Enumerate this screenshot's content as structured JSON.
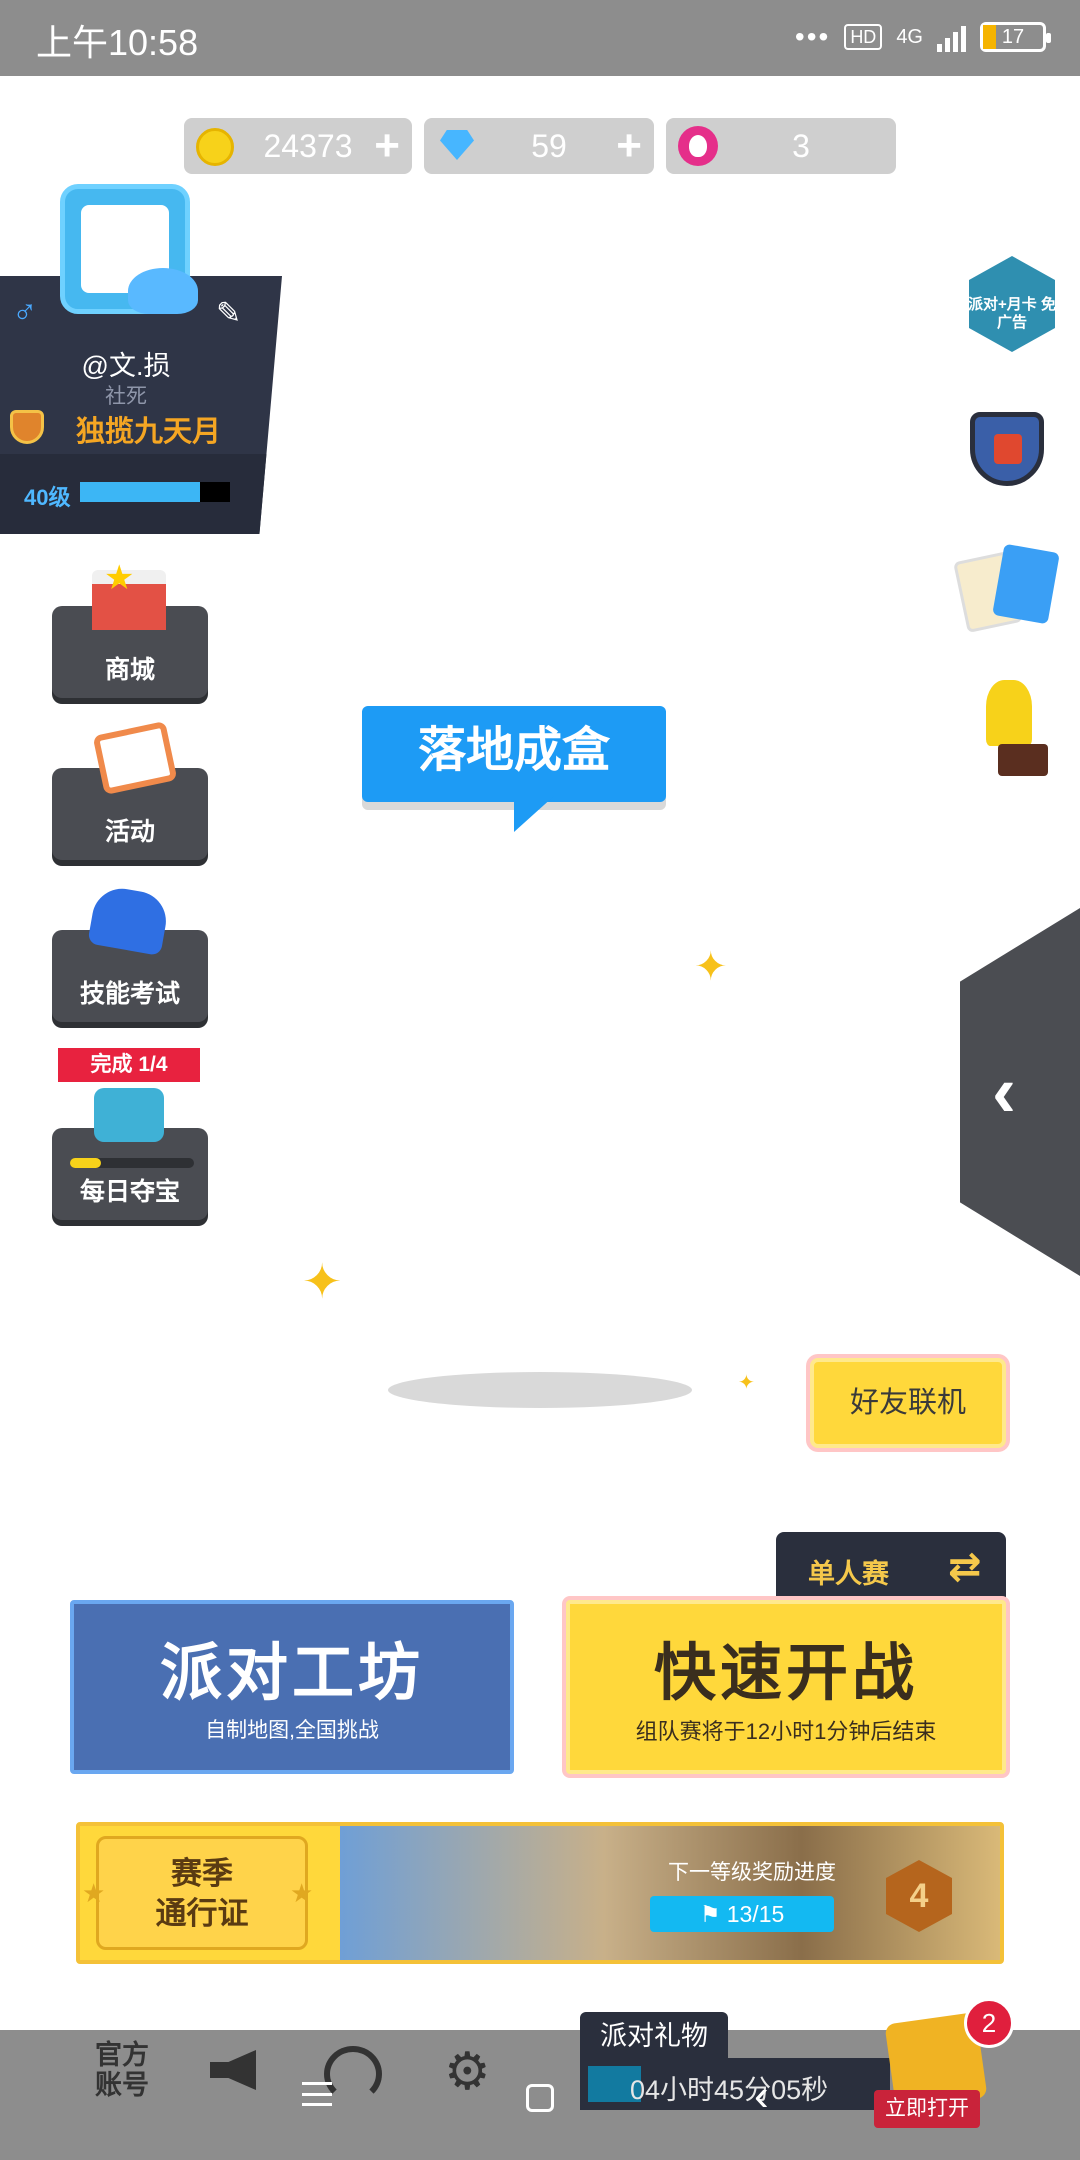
{
  "status_bar": {
    "time": "上午10:58",
    "dots": "•••",
    "hd_label": "HD",
    "network_label": "4G",
    "battery": "17"
  },
  "currency": {
    "coins": "24373",
    "gems": "59",
    "lotus": "3",
    "plus": "+"
  },
  "profile": {
    "username": "@文.损",
    "subtitle": "社死",
    "title": "独揽九天月",
    "level_label": "40级",
    "level_progress": 0.8,
    "gender_symbol": "♂",
    "edit_symbol": "✎"
  },
  "left_menu": {
    "shop_label": "商城",
    "events_label": "活动",
    "skill_test_label": "技能考试",
    "daily_treasure_label": "每日夺宝",
    "daily_treasure_badge": "完成 1/4",
    "daily_treasure_progress": 0.25
  },
  "right_menu": {
    "ad_card_text": "派对+月卡 免广告"
  },
  "center": {
    "mode_banner": "落地成盒",
    "sparkle": "✦"
  },
  "side_tab": {
    "arrow": "‹"
  },
  "buttons": {
    "friends": "好友联机",
    "single_tab": "单人赛",
    "swap_icon": "⇄",
    "workshop_title": "派对工坊",
    "workshop_sub": "自制地图,全国挑战",
    "quick_title": "快速开战",
    "quick_sub": "组队赛将于12小时1分钟后结束"
  },
  "season_pass": {
    "title_line1": "赛季",
    "title_line2": "通行证",
    "progress_label": "下一等级奖励进度",
    "progress_value": "13/15",
    "flag": "⚑",
    "level": "4",
    "star": "★"
  },
  "bottom_bar": {
    "official_line1": "官方",
    "official_line2": "账号",
    "gear": "⚙",
    "party_gift_label": "派对礼物",
    "timer": "04小时45分05秒",
    "timer_progress": 0.18,
    "notification_count": "2",
    "open_now_label": "立即打开"
  },
  "nav": {
    "back": "‹"
  },
  "colors": {
    "accent_blue": "#1d9bf5",
    "accent_yellow": "#ffd83b",
    "badge_red": "#e8223f",
    "dark_panel": "#2f3547"
  }
}
